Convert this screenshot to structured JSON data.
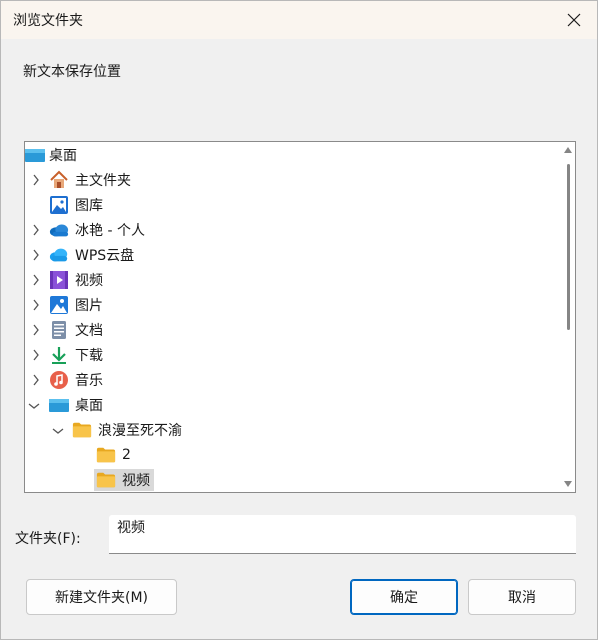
{
  "window": {
    "title": "浏览文件夹",
    "close_glyph": "✕"
  },
  "instruction": "新文本保存位置",
  "tree": {
    "items": [
      {
        "label": "桌面",
        "icon": "desktop-icon",
        "chevron": "none",
        "level": "root"
      },
      {
        "label": "主文件夹",
        "icon": "home-icon",
        "chevron": "collapsed"
      },
      {
        "label": "图库",
        "icon": "gallery-icon",
        "chevron": "none"
      },
      {
        "label": "冰艳 - 个人",
        "icon": "onedrive-icon",
        "chevron": "collapsed"
      },
      {
        "label": "WPS云盘",
        "icon": "wps-cloud-icon",
        "chevron": "collapsed"
      },
      {
        "label": "视频",
        "icon": "videos-icon",
        "chevron": "collapsed"
      },
      {
        "label": "图片",
        "icon": "pictures-icon",
        "chevron": "collapsed"
      },
      {
        "label": "文档",
        "icon": "documents-icon",
        "chevron": "collapsed"
      },
      {
        "label": "下载",
        "icon": "downloads-icon",
        "chevron": "collapsed"
      },
      {
        "label": "音乐",
        "icon": "music-icon",
        "chevron": "collapsed"
      },
      {
        "label": "桌面",
        "icon": "desktop-icon",
        "chevron": "expanded"
      },
      {
        "label": "浪漫至死不渝",
        "icon": "folder-icon",
        "chevron": "expanded"
      },
      {
        "label": "2",
        "icon": "folder-icon",
        "chevron": "none"
      },
      {
        "label": "视频",
        "icon": "folder-icon",
        "chevron": "none",
        "selected": true
      }
    ]
  },
  "folder_field": {
    "label": "文件夹(F):",
    "value": "视频"
  },
  "buttons": {
    "new_folder": "新建文件夹(M)",
    "ok": "确定",
    "cancel": "取消"
  },
  "colors": {
    "accent": "#0067c0",
    "titlebar": "#faf5ef",
    "background": "#f0f0f0",
    "selection": "#d9d9d9",
    "folder_yellow": "#f8c44a"
  }
}
